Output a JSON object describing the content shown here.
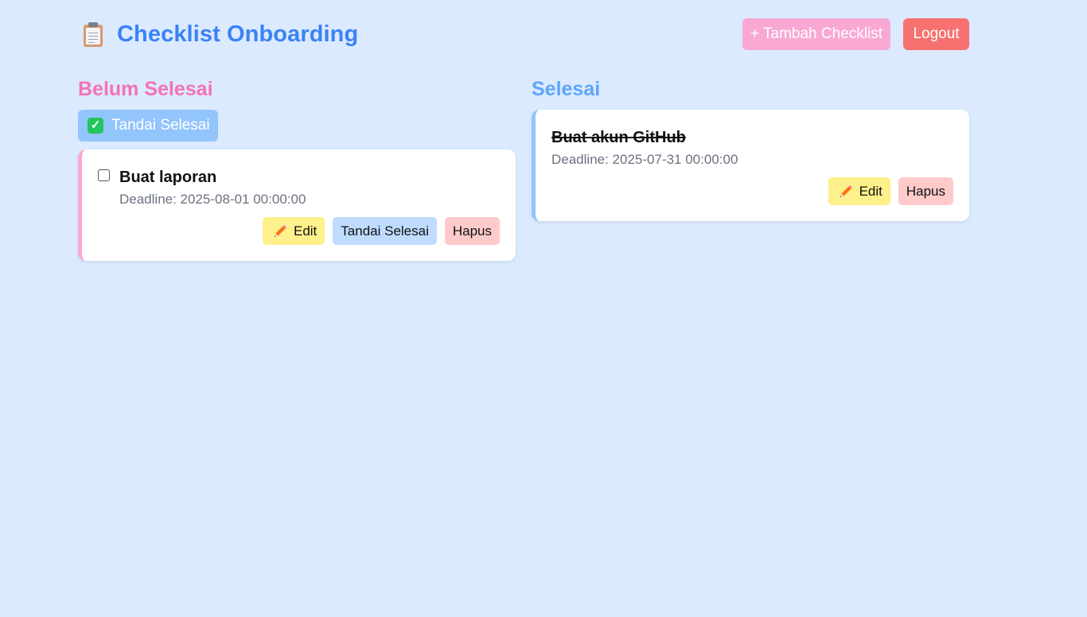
{
  "header": {
    "title": "Checklist Onboarding",
    "add_label": "+ Tambah Checklist",
    "logout_label": "Logout"
  },
  "pending": {
    "heading": "Belum Selesai",
    "mark_all_label": "Tandai Selesai",
    "items": [
      {
        "title": "Buat laporan",
        "deadline": "Deadline: 2025-08-01 00:00:00",
        "checked": false,
        "edit_label": "Edit",
        "done_label": "Tandai Selesai",
        "delete_label": "Hapus"
      }
    ]
  },
  "done": {
    "heading": "Selesai",
    "items": [
      {
        "title": "Buat akun GitHub",
        "deadline": "Deadline: 2025-07-31 00:00:00",
        "edit_label": "Edit",
        "delete_label": "Hapus"
      }
    ]
  },
  "icons": {
    "logo": "clipboard-icon",
    "mark_all": "check-mark-button-icon",
    "edit": "pencil-icon"
  },
  "colors": {
    "background": "#dbeafe",
    "title": "#3b82f6",
    "pending_heading": "#f472b6",
    "done_heading": "#60a5fa",
    "add_button": "#f9a8d4",
    "logout_button": "#f87171",
    "edit_button": "#fef08a",
    "done_button": "#bfdbfe",
    "delete_button": "#fecaca"
  }
}
